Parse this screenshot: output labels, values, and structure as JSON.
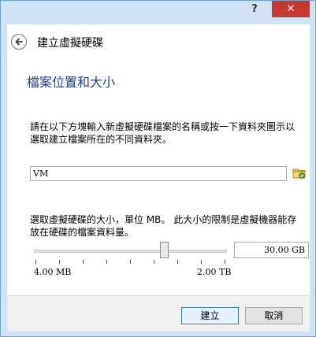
{
  "titlebar": {
    "help_label": "?",
    "close_label": "✕"
  },
  "header": {
    "title": "建立虛擬硬碟"
  },
  "page": {
    "title": "檔案位置和大小",
    "location_desc": "請在以下方塊輸入新虛擬硬碟檔案的名稱或按一下資料夾圖示以選取建立檔案所在的不同資料夾。",
    "location_value": "VM",
    "size_desc": "選取虛擬硬碟的大小，單位 MB。 此大小的限制是虛擬機器能存放在硬碟的檔案資料量。",
    "slider_min_label": "4.00 MB",
    "slider_max_label": "2.00 TB",
    "size_value": "30.00 GB"
  },
  "footer": {
    "create_label": "建立",
    "cancel_label": "取消"
  },
  "icons": {
    "back": "back-arrow-icon",
    "folder": "folder-icon"
  }
}
